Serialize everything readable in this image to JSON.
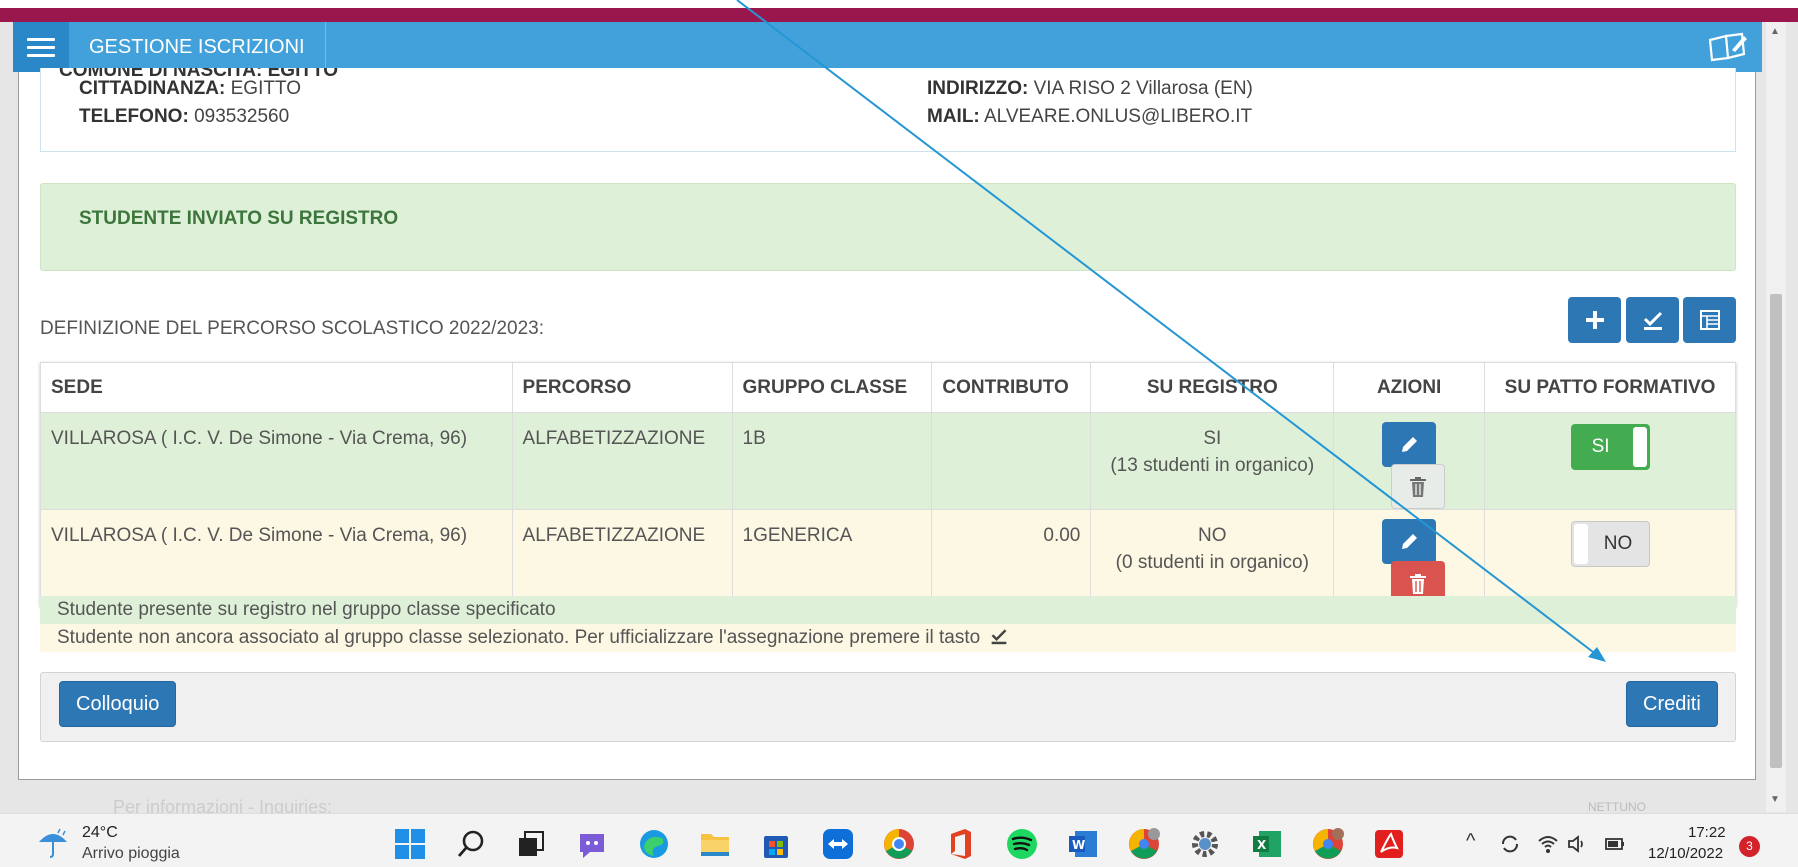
{
  "app": {
    "title": "GESTIONE ISCRIZIONI"
  },
  "info": {
    "cut_label": "COMUNE DI NASCITA: EGITTO",
    "cittadinanza_label": "CITTADINANZA:",
    "cittadinanza_value": "EGITTO",
    "telefono_label": "TELEFONO:",
    "telefono_value": "093532560",
    "indirizzo_label": "INDIRIZZO:",
    "indirizzo_value": "VIA RISO 2 Villarosa (EN)",
    "mail_label": "MAIL:",
    "mail_value": "ALVEARE.ONLUS@LIBERO.IT"
  },
  "alert": {
    "text": "STUDENTE INVIATO SU REGISTRO"
  },
  "percorso": {
    "title": "DEFINIZIONE DEL PERCORSO SCOLASTICO 2022/2023:"
  },
  "table": {
    "headers": [
      "SEDE",
      "PERCORSO",
      "GRUPPO CLASSE",
      "CONTRIBUTO",
      "SU REGISTRO",
      "AZIONI",
      "SU PATTO FORMATIVO"
    ],
    "rows": [
      {
        "sede": "VILLAROSA ( I.C. V. De Simone - Via Crema, 96)",
        "percorso": "ALFABETIZZAZIONE",
        "gruppo": "1B",
        "contributo": "",
        "registro": "SI",
        "registro_note": "(13 studenti in organico)",
        "patto": "SI"
      },
      {
        "sede": "VILLAROSA ( I.C. V. De Simone - Via Crema, 96)",
        "percorso": "ALFABETIZZAZIONE",
        "gruppo": "1GENERICA",
        "contributo": "0.00",
        "registro": "NO",
        "registro_note": "(0 studenti in organico)",
        "patto": "NO"
      }
    ]
  },
  "legend": {
    "green": "Studente presente su registro nel gruppo classe specificato",
    "yellow": "Studente non ancora associato al gruppo classe selezionato. Per ufficializzare l'assegnazione premere il tasto"
  },
  "buttons": {
    "colloquio": "Colloquio",
    "crediti": "Crediti"
  },
  "footer": {
    "text": "Per informazioni - Inquiries:",
    "brand": "NETTUNO"
  },
  "taskbar": {
    "weather_temp": "24°C",
    "weather_desc": "Arrivo pioggia",
    "time": "17:22",
    "date": "12/10/2022",
    "notifications": "3"
  },
  "colors": {
    "accent": "#42a1db",
    "brand_bar": "#99174d",
    "primary": "#2d77b5",
    "success": "#43ac51",
    "danger": "#d9534f"
  }
}
